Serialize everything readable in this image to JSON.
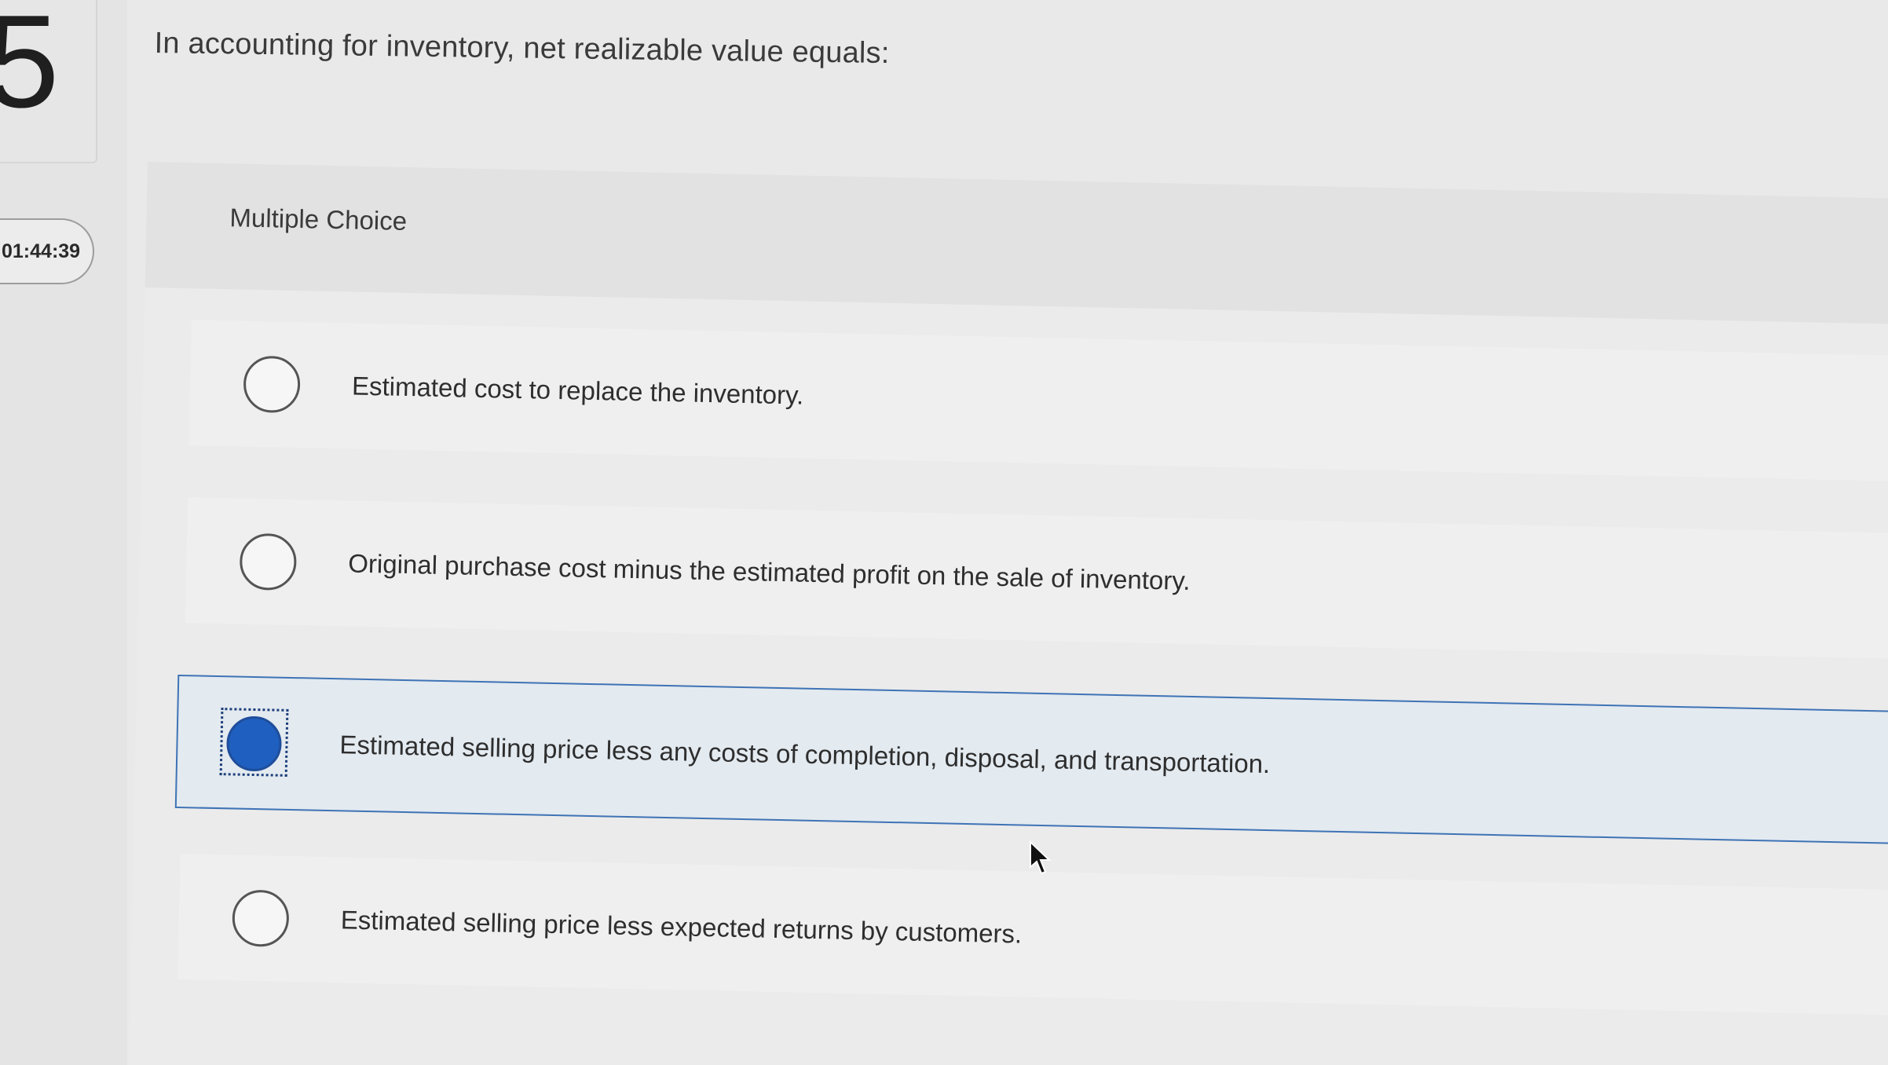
{
  "question_number": "5",
  "timer": "01:44:39",
  "question_text": "In accounting for inventory, net realizable value equals:",
  "question_type": "Multiple Choice",
  "options": [
    {
      "label": "Estimated cost to replace the inventory.",
      "selected": false
    },
    {
      "label": "Original purchase cost minus the estimated profit on the sale of inventory.",
      "selected": false
    },
    {
      "label": "Estimated selling price less any costs of completion, disposal, and transportation.",
      "selected": true
    },
    {
      "label": "Estimated selling price less expected returns by customers.",
      "selected": false
    }
  ],
  "colors": {
    "selected_fill": "#1f5fbf",
    "selected_border": "#3f73b5",
    "selected_background": "#e3eaf0"
  }
}
